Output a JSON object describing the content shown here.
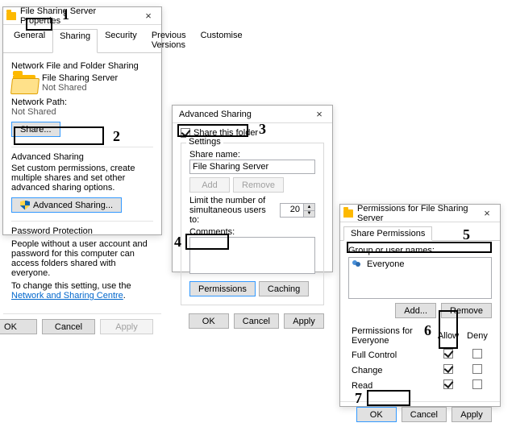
{
  "propsDialog": {
    "title": "File Sharing Server Properties",
    "tabs": [
      "General",
      "Sharing",
      "Security",
      "Previous Versions",
      "Customise"
    ],
    "activeTab": 1,
    "netGroup": {
      "legend": "Network File and Folder Sharing",
      "name": "File Sharing Server",
      "status": "Not Shared",
      "pathLabel": "Network Path:",
      "pathValue": "Not Shared",
      "shareBtn": "Share..."
    },
    "advGroup": {
      "legend": "Advanced Sharing",
      "desc": "Set custom permissions, create multiple shares and set other advanced sharing options.",
      "btn": "Advanced Sharing..."
    },
    "pwdGroup": {
      "legend": "Password Protection",
      "line1": "People without a user account and password for this computer can access folders shared with everyone.",
      "line2a": "To change this setting, use the ",
      "link": "Network and Sharing Centre",
      "line2b": "."
    },
    "buttons": {
      "ok": "OK",
      "cancel": "Cancel",
      "apply": "Apply"
    }
  },
  "advDialog": {
    "title": "Advanced Sharing",
    "shareThis": "Share this folder",
    "settingsLegend": "Settings",
    "shareNameLabel": "Share name:",
    "shareName": "File Sharing Server",
    "addBtn": "Add",
    "removeBtn": "Remove",
    "limitLabel": "Limit the number of simultaneous users to:",
    "limitVal": "20",
    "commentsLabel": "Comments:",
    "permBtn": "Permissions",
    "cacheBtn": "Caching",
    "buttons": {
      "ok": "OK",
      "cancel": "Cancel",
      "apply": "Apply"
    }
  },
  "permDialog": {
    "title": "Permissions for File Sharing Server",
    "tab": "Share Permissions",
    "groupLabel": "Group or user names:",
    "everyone": "Everyone",
    "addBtn": "Add...",
    "removeBtn": "Remove",
    "permForLabel": "Permissions for Everyone",
    "allow": "Allow",
    "deny": "Deny",
    "perms": [
      {
        "label": "Full Control",
        "allow": true,
        "deny": false
      },
      {
        "label": "Change",
        "allow": true,
        "deny": false
      },
      {
        "label": "Read",
        "allow": true,
        "deny": false
      }
    ],
    "buttons": {
      "ok": "OK",
      "cancel": "Cancel",
      "apply": "Apply"
    }
  },
  "annotations": {
    "a1": "1",
    "a2": "2",
    "a3": "3",
    "a4": "4",
    "a5": "5",
    "a6": "6",
    "a7": "7"
  }
}
